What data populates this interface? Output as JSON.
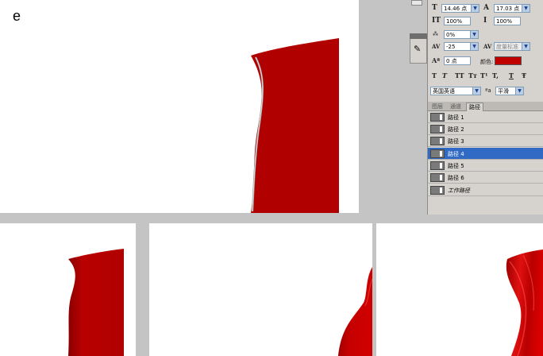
{
  "step_label": "e",
  "colors": {
    "shape_red": "#b00000",
    "selection_blue": "#316ac5",
    "panel_bg": "#d6d3ce",
    "color_swatch": "#c00000"
  },
  "character_panel": {
    "font_size": "14.46 点",
    "leading": "17.03 点",
    "vertical_scale": "100%",
    "horizontal_scale": "100%",
    "tsume": "0%",
    "tracking": "-25",
    "kerning": "度量标准",
    "baseline_shift": "0 点",
    "color_label": "颜色:",
    "style_buttons": [
      "T",
      "T",
      "TT",
      "Tт",
      "T¹",
      "T,",
      "T",
      "Ŧ"
    ],
    "language": "英国英语",
    "aa_label": "a",
    "antialias": "平滑"
  },
  "paths_panel": {
    "tabs": [
      "图层",
      "通道",
      "路径"
    ],
    "active_tab": "路径",
    "items": [
      {
        "label": "路径 1",
        "selected": false
      },
      {
        "label": "路径 2",
        "selected": false
      },
      {
        "label": "路径 3",
        "selected": false
      },
      {
        "label": "路径 4",
        "selected": true
      },
      {
        "label": "路径 5",
        "selected": false
      },
      {
        "label": "路径 6",
        "selected": false
      },
      {
        "label": "工作路径",
        "selected": false,
        "italic": true
      }
    ]
  }
}
